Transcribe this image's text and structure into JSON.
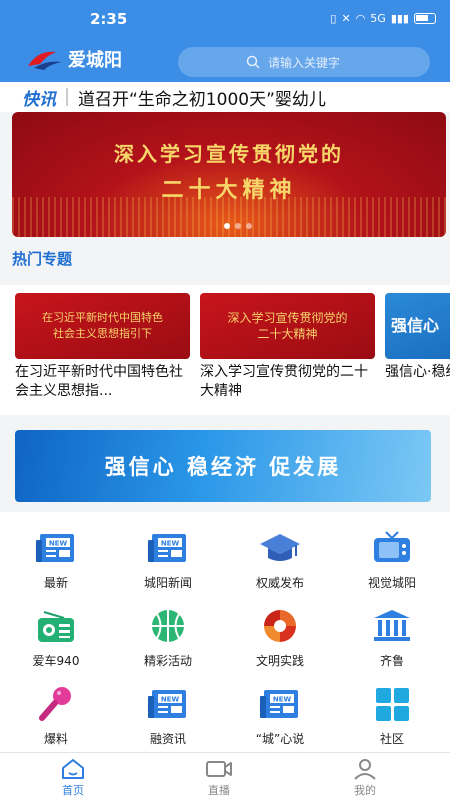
{
  "status_bar": {
    "time": "2:35",
    "network": "5G"
  },
  "header": {
    "app_name": "爱城阳",
    "search_placeholder": "请输入关键字"
  },
  "ticker": {
    "label": "快讯",
    "text": "道召开“生命之初1000天”婴幼儿"
  },
  "banner": {
    "line1": "深入学习宣传贯彻党的",
    "line2": "二十大精神",
    "slides": 3,
    "active_slide": 1
  },
  "hot_topics": {
    "title": "热门专题",
    "items": [
      {
        "thumb_l1": "在习近平新时代中国特色",
        "thumb_l2": "社会主义思想指引下",
        "title": "在习近平新时代中国特色社会主义思想指..."
      },
      {
        "thumb_l1": "深入学习宣传贯彻党的",
        "thumb_l2": "二十大精神",
        "title": "深入学习宣传贯彻党的二十大精神"
      },
      {
        "thumb_l1": "强信心",
        "thumb_l2": "",
        "title": "强信心·稳经济·促发展"
      }
    ]
  },
  "promo": {
    "text": "强信心 稳经济 促发展"
  },
  "grid": [
    {
      "label": "最新",
      "icon": "news-icon"
    },
    {
      "label": "城阳新闻",
      "icon": "news-icon"
    },
    {
      "label": "权威发布",
      "icon": "graduation-cap-icon"
    },
    {
      "label": "视觉城阳",
      "icon": "tv-icon"
    },
    {
      "label": "爱车940",
      "icon": "radio-icon"
    },
    {
      "label": "精彩活动",
      "icon": "basketball-icon"
    },
    {
      "label": "文明实践",
      "icon": "emblem-icon"
    },
    {
      "label": "齐鲁",
      "icon": "building-icon"
    },
    {
      "label": "爆料",
      "icon": "microphone-icon"
    },
    {
      "label": "融资讯",
      "icon": "news-icon"
    },
    {
      "label": "“城”心说",
      "icon": "news-icon"
    },
    {
      "label": "社区",
      "icon": "grid-icon"
    }
  ],
  "tabbar": [
    {
      "label": "首页",
      "icon": "home-icon",
      "active": true
    },
    {
      "label": "直播",
      "icon": "video-camera-icon",
      "active": false
    },
    {
      "label": "我的",
      "icon": "user-icon",
      "active": false
    }
  ],
  "colors": {
    "brand_blue": "#3b8de6",
    "accent_red": "#b3121a",
    "link_blue": "#1f6fd1"
  }
}
